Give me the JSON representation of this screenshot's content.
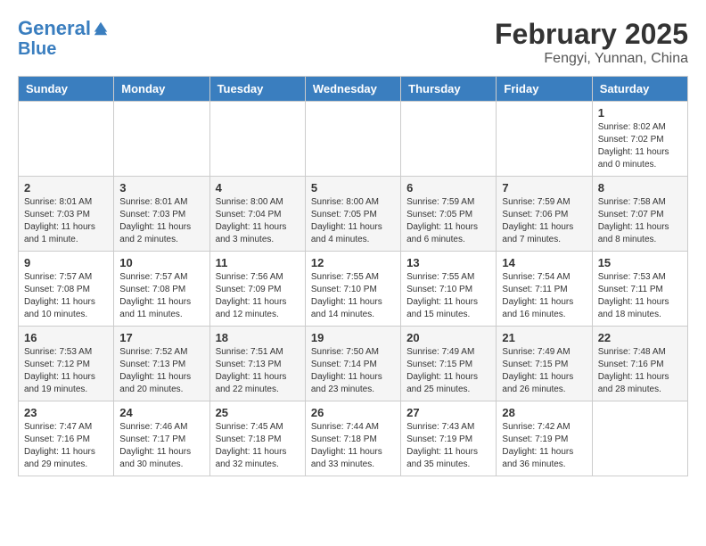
{
  "header": {
    "logo_line1": "General",
    "logo_line2": "Blue",
    "month": "February 2025",
    "location": "Fengyi, Yunnan, China"
  },
  "weekdays": [
    "Sunday",
    "Monday",
    "Tuesday",
    "Wednesday",
    "Thursday",
    "Friday",
    "Saturday"
  ],
  "weeks": [
    [
      {
        "day": "",
        "info": ""
      },
      {
        "day": "",
        "info": ""
      },
      {
        "day": "",
        "info": ""
      },
      {
        "day": "",
        "info": ""
      },
      {
        "day": "",
        "info": ""
      },
      {
        "day": "",
        "info": ""
      },
      {
        "day": "1",
        "info": "Sunrise: 8:02 AM\nSunset: 7:02 PM\nDaylight: 11 hours\nand 0 minutes."
      }
    ],
    [
      {
        "day": "2",
        "info": "Sunrise: 8:01 AM\nSunset: 7:03 PM\nDaylight: 11 hours\nand 1 minute."
      },
      {
        "day": "3",
        "info": "Sunrise: 8:01 AM\nSunset: 7:03 PM\nDaylight: 11 hours\nand 2 minutes."
      },
      {
        "day": "4",
        "info": "Sunrise: 8:00 AM\nSunset: 7:04 PM\nDaylight: 11 hours\nand 3 minutes."
      },
      {
        "day": "5",
        "info": "Sunrise: 8:00 AM\nSunset: 7:05 PM\nDaylight: 11 hours\nand 4 minutes."
      },
      {
        "day": "6",
        "info": "Sunrise: 7:59 AM\nSunset: 7:05 PM\nDaylight: 11 hours\nand 6 minutes."
      },
      {
        "day": "7",
        "info": "Sunrise: 7:59 AM\nSunset: 7:06 PM\nDaylight: 11 hours\nand 7 minutes."
      },
      {
        "day": "8",
        "info": "Sunrise: 7:58 AM\nSunset: 7:07 PM\nDaylight: 11 hours\nand 8 minutes."
      }
    ],
    [
      {
        "day": "9",
        "info": "Sunrise: 7:57 AM\nSunset: 7:08 PM\nDaylight: 11 hours\nand 10 minutes."
      },
      {
        "day": "10",
        "info": "Sunrise: 7:57 AM\nSunset: 7:08 PM\nDaylight: 11 hours\nand 11 minutes."
      },
      {
        "day": "11",
        "info": "Sunrise: 7:56 AM\nSunset: 7:09 PM\nDaylight: 11 hours\nand 12 minutes."
      },
      {
        "day": "12",
        "info": "Sunrise: 7:55 AM\nSunset: 7:10 PM\nDaylight: 11 hours\nand 14 minutes."
      },
      {
        "day": "13",
        "info": "Sunrise: 7:55 AM\nSunset: 7:10 PM\nDaylight: 11 hours\nand 15 minutes."
      },
      {
        "day": "14",
        "info": "Sunrise: 7:54 AM\nSunset: 7:11 PM\nDaylight: 11 hours\nand 16 minutes."
      },
      {
        "day": "15",
        "info": "Sunrise: 7:53 AM\nSunset: 7:11 PM\nDaylight: 11 hours\nand 18 minutes."
      }
    ],
    [
      {
        "day": "16",
        "info": "Sunrise: 7:53 AM\nSunset: 7:12 PM\nDaylight: 11 hours\nand 19 minutes."
      },
      {
        "day": "17",
        "info": "Sunrise: 7:52 AM\nSunset: 7:13 PM\nDaylight: 11 hours\nand 20 minutes."
      },
      {
        "day": "18",
        "info": "Sunrise: 7:51 AM\nSunset: 7:13 PM\nDaylight: 11 hours\nand 22 minutes."
      },
      {
        "day": "19",
        "info": "Sunrise: 7:50 AM\nSunset: 7:14 PM\nDaylight: 11 hours\nand 23 minutes."
      },
      {
        "day": "20",
        "info": "Sunrise: 7:49 AM\nSunset: 7:15 PM\nDaylight: 11 hours\nand 25 minutes."
      },
      {
        "day": "21",
        "info": "Sunrise: 7:49 AM\nSunset: 7:15 PM\nDaylight: 11 hours\nand 26 minutes."
      },
      {
        "day": "22",
        "info": "Sunrise: 7:48 AM\nSunset: 7:16 PM\nDaylight: 11 hours\nand 28 minutes."
      }
    ],
    [
      {
        "day": "23",
        "info": "Sunrise: 7:47 AM\nSunset: 7:16 PM\nDaylight: 11 hours\nand 29 minutes."
      },
      {
        "day": "24",
        "info": "Sunrise: 7:46 AM\nSunset: 7:17 PM\nDaylight: 11 hours\nand 30 minutes."
      },
      {
        "day": "25",
        "info": "Sunrise: 7:45 AM\nSunset: 7:18 PM\nDaylight: 11 hours\nand 32 minutes."
      },
      {
        "day": "26",
        "info": "Sunrise: 7:44 AM\nSunset: 7:18 PM\nDaylight: 11 hours\nand 33 minutes."
      },
      {
        "day": "27",
        "info": "Sunrise: 7:43 AM\nSunset: 7:19 PM\nDaylight: 11 hours\nand 35 minutes."
      },
      {
        "day": "28",
        "info": "Sunrise: 7:42 AM\nSunset: 7:19 PM\nDaylight: 11 hours\nand 36 minutes."
      },
      {
        "day": "",
        "info": ""
      }
    ]
  ]
}
